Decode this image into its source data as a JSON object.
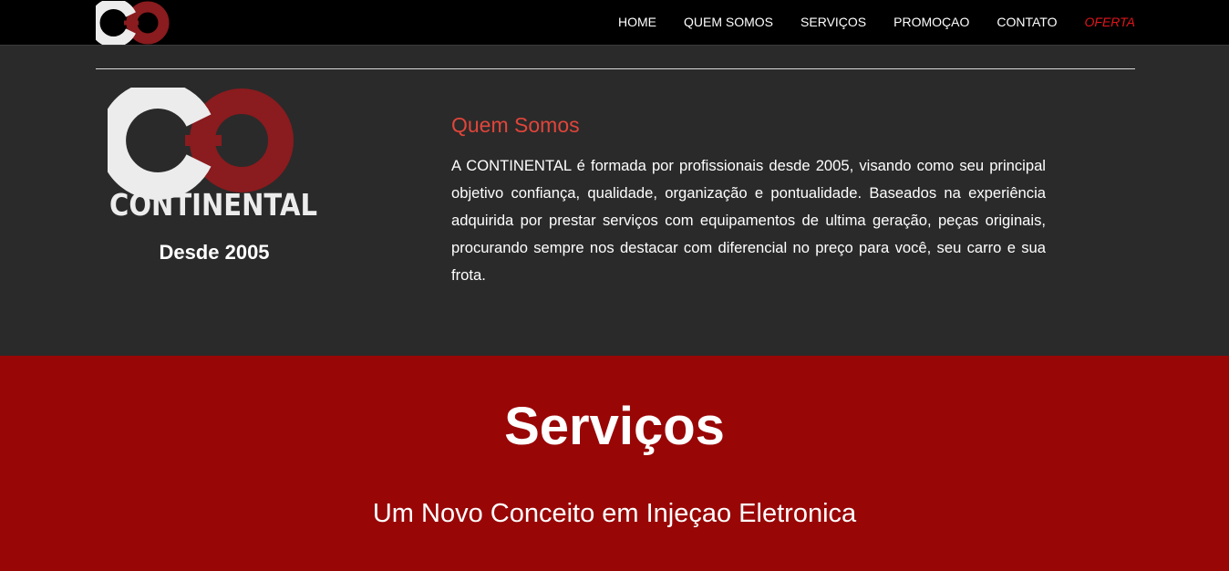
{
  "colors": {
    "nav_background": "#000000",
    "page_background": "#2a2a2a",
    "services_background": "#990606",
    "accent_red": "#e0151d",
    "heading_red": "#e0453a",
    "logo_white": "#ececec",
    "logo_red": "#8a1b1e"
  },
  "nav": {
    "logo_icon": "continental-cc-logo",
    "items": [
      {
        "label": "HOME"
      },
      {
        "label": "QUEM SOMOS"
      },
      {
        "label": "SERVIÇOS"
      },
      {
        "label": "PROMOÇAO"
      },
      {
        "label": "CONTATO"
      },
      {
        "label": "OFERTA"
      }
    ]
  },
  "about": {
    "logo_text": "CONTINENTAL",
    "since": "Desde 2005",
    "title": "Quem Somos",
    "body": "A CONTINENTAL é formada por profissionais desde 2005, visando como seu principal objetivo confiança, qualidade, organização e pontualidade. Baseados na experiência adquirida por prestar serviços com equipamentos de ultima geração, peças originais, procurando sempre nos destacar com diferencial no preço para você, seu carro e sua frota."
  },
  "services": {
    "title": "Serviços",
    "subtitle": "Um Novo Conceito em Injeçao Eletronica"
  }
}
